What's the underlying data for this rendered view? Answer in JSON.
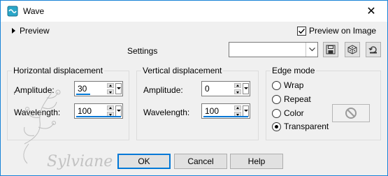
{
  "window": {
    "title": "Wave",
    "close_glyph": "✕",
    "app_icon": "wave-app-icon"
  },
  "preview": {
    "toggle_label": "Preview",
    "on_image_label": "Preview on Image",
    "on_image_checked": true
  },
  "settings": {
    "label": "Settings",
    "preset_value": ""
  },
  "horizontal": {
    "title": "Horizontal displacement",
    "amplitude_label": "Amplitude:",
    "amplitude_value": "30",
    "wavelength_label": "Wavelength:",
    "wavelength_value": "100"
  },
  "vertical": {
    "title": "Vertical displacement",
    "amplitude_label": "Amplitude:",
    "amplitude_value": "0",
    "wavelength_label": "Wavelength:",
    "wavelength_value": "100"
  },
  "edge_mode": {
    "title": "Edge mode",
    "options": [
      "Wrap",
      "Repeat",
      "Color",
      "Transparent"
    ],
    "selected": "Transparent"
  },
  "buttons": {
    "ok": "OK",
    "cancel": "Cancel",
    "help": "Help"
  },
  "watermark": {
    "text": "Sylviane"
  },
  "colors": {
    "accent": "#0078d7",
    "window_border": "#1883d7",
    "dialog_bg": "#f0f0f0"
  }
}
